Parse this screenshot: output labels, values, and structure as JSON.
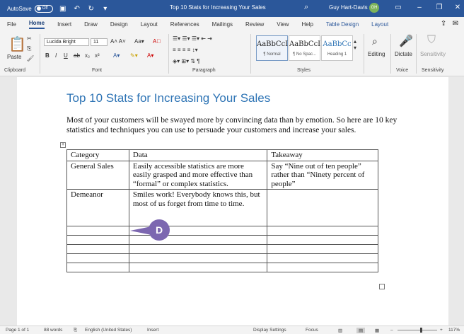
{
  "titlebar": {
    "autosave_label": "AutoSave",
    "autosave_state": "Off",
    "doc_title": "Top 10 Stats for Increasing Your Sales",
    "user_name": "Guy Hart-Davis",
    "user_initials": "GH"
  },
  "tabs": [
    "File",
    "Home",
    "Insert",
    "Draw",
    "Design",
    "Layout",
    "References",
    "Mailings",
    "Review",
    "View",
    "Help",
    "Table Design",
    "Layout"
  ],
  "ribbon": {
    "paste_label": "Paste",
    "clipboard_label": "Clipboard",
    "font_name": "Lucida Bright",
    "font_size": "11",
    "font_label": "Font",
    "paragraph_label": "Paragraph",
    "styles_label": "Styles",
    "styles": [
      {
        "sample": "AaBbCcI",
        "name": "¶ Normal"
      },
      {
        "sample": "AaBbCcI",
        "name": "¶ No Spac..."
      },
      {
        "sample": "AaBbCc",
        "name": "Heading 1"
      }
    ],
    "editing_label": "Editing",
    "dictate_label": "Dictate",
    "voice_label": "Voice",
    "sensitivity_label": "Sensitivity"
  },
  "document": {
    "heading": "Top 10 Stats for Increasing Your Sales",
    "paragraph": "Most of your customers will be swayed more by convincing data than by emotion. So here are 10 key statistics and techniques you can use to persuade your customers and increase your sales.",
    "table": {
      "headers": [
        "Category",
        "Data",
        "Takeaway"
      ],
      "rows": [
        [
          "General Sales",
          "Easily accessible statistics are more easily grasped and more effective than “formal” or complex statistics.",
          "Say “Nine out of ten people” rather than “Ninety percent of people”"
        ],
        [
          "Demeanor",
          "Smiles work! Everybody knows this, but most of us forget from time to time.",
          ""
        ]
      ]
    },
    "callout_letter": "D"
  },
  "statusbar": {
    "page": "Page 1 of 1",
    "words": "88 words",
    "language": "English (United States)",
    "mode": "Insert",
    "display_settings": "Display Settings",
    "focus": "Focus",
    "zoom": "117%"
  }
}
